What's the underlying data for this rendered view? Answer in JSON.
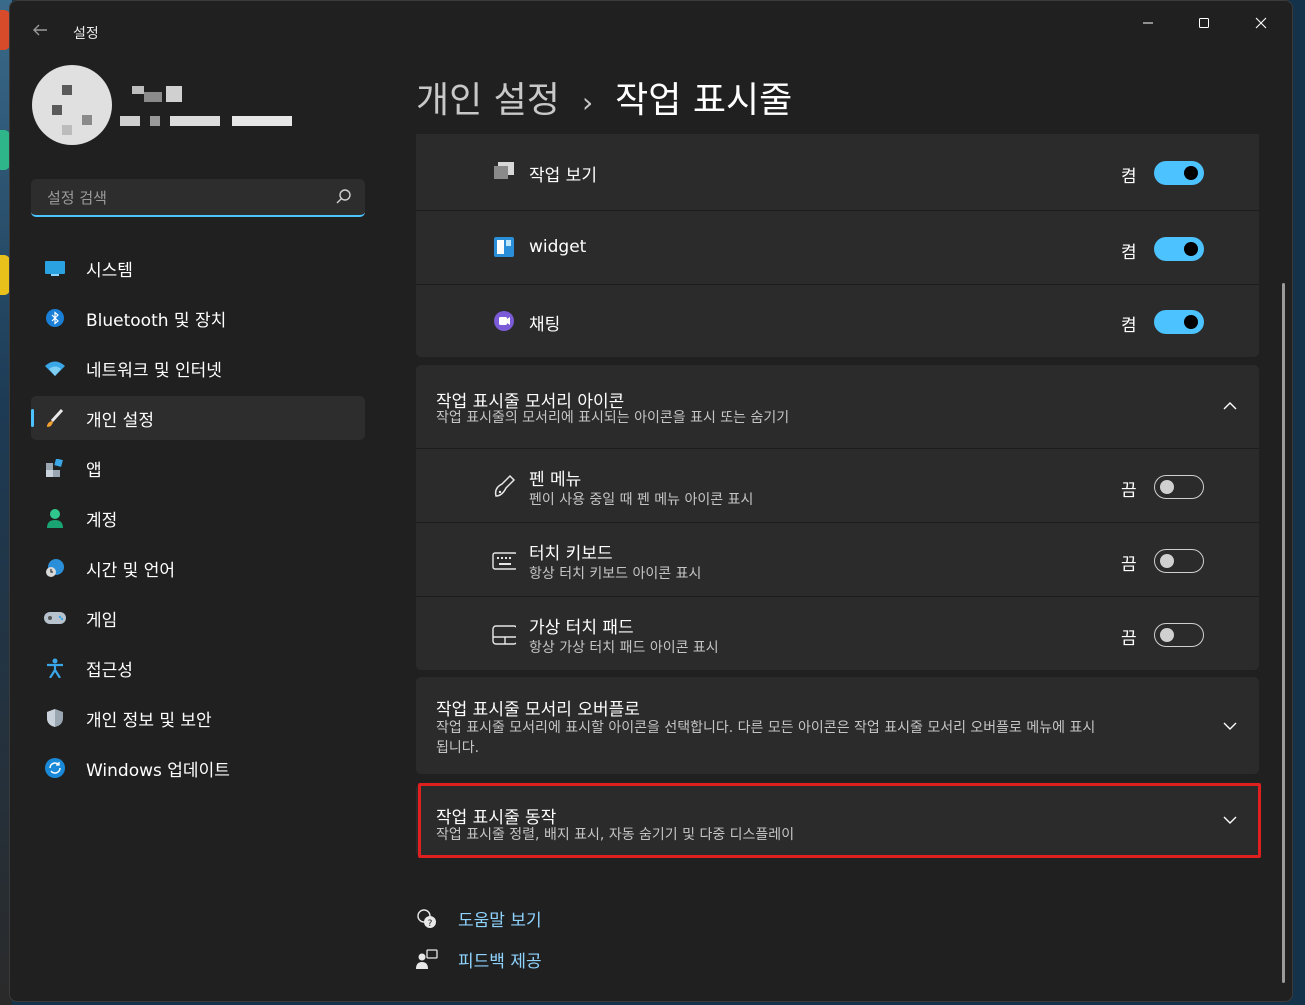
{
  "window": {
    "title": "설정"
  },
  "sidebar": {
    "search_placeholder": "설정 검색",
    "items": [
      {
        "label": "시스템",
        "icon": "monitor-icon"
      },
      {
        "label": "Bluetooth 및 장치",
        "icon": "bluetooth-icon"
      },
      {
        "label": "네트워크 및 인터넷",
        "icon": "wifi-icon"
      },
      {
        "label": "개인 설정",
        "icon": "brush-icon",
        "active": true
      },
      {
        "label": "앱",
        "icon": "apps-icon"
      },
      {
        "label": "계정",
        "icon": "person-icon"
      },
      {
        "label": "시간 및 언어",
        "icon": "globe-clock-icon"
      },
      {
        "label": "게임",
        "icon": "gamepad-icon"
      },
      {
        "label": "접근성",
        "icon": "accessibility-icon"
      },
      {
        "label": "개인 정보 및 보안",
        "icon": "shield-icon"
      },
      {
        "label": "Windows 업데이트",
        "icon": "update-icon"
      }
    ]
  },
  "breadcrumb": {
    "parent": "개인 설정",
    "separator": "›",
    "current": "작업 표시줄"
  },
  "taskbar_items": [
    {
      "title": "작업 보기",
      "state": "켬",
      "on": true,
      "icon": "task-view-icon"
    },
    {
      "title": "widget",
      "state": "켬",
      "on": true,
      "icon": "widgets-icon"
    },
    {
      "title": "채팅",
      "state": "켬",
      "on": true,
      "icon": "chat-icon"
    }
  ],
  "corner_icons": {
    "title": "작업 표시줄 모서리 아이콘",
    "subtitle": "작업 표시줄의 모서리에 표시되는 아이콘을 표시 또는 숨기기",
    "items": [
      {
        "title": "펜 메뉴",
        "subtitle": "펜이 사용 중일 때 펜 메뉴 아이콘 표시",
        "state": "끔",
        "on": false,
        "icon": "pen-icon"
      },
      {
        "title": "터치 키보드",
        "subtitle": "항상 터치 키보드 아이콘 표시",
        "state": "끔",
        "on": false,
        "icon": "keyboard-icon"
      },
      {
        "title": "가상 터치 패드",
        "subtitle": "항상 가상 터치 패드 아이콘 표시",
        "state": "끔",
        "on": false,
        "icon": "touchpad-icon"
      }
    ]
  },
  "corner_overflow": {
    "title": "작업 표시줄 모서리 오버플로",
    "subtitle_line1": "작업 표시줄 모서리에 표시할 아이콘을 선택합니다. 다른 모든 아이콘은 작업 표시줄 모서리 오버플로 메뉴에 표시",
    "subtitle_line2": "됩니다."
  },
  "behaviors": {
    "title": "작업 표시줄 동작",
    "subtitle": "작업 표시줄 정렬, 배지 표시, 자동 숨기기 및 다중 디스플레이"
  },
  "links": {
    "help": "도움말 보기",
    "feedback": "피드백 제공"
  },
  "colors": {
    "accent": "#4cc2ff",
    "highlight": "#e0201f",
    "background": "#202020",
    "card": "#2b2b2b"
  }
}
